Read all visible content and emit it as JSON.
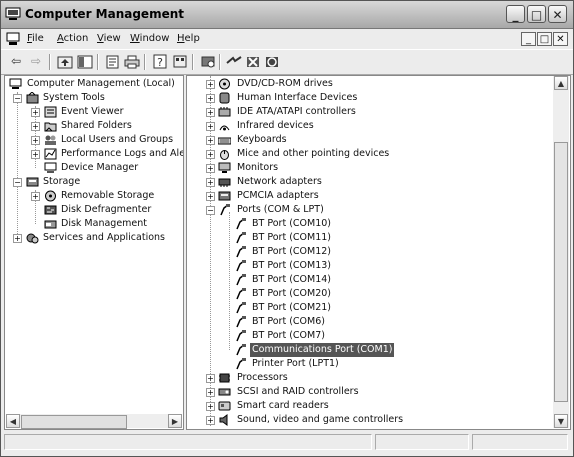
{
  "window": {
    "title": "Computer Management"
  },
  "menu": {
    "items": [
      {
        "underline": "F",
        "rest": "ile"
      },
      {
        "underline": "A",
        "rest": "ction"
      },
      {
        "underline": "V",
        "rest": "iew"
      },
      {
        "underline": "W",
        "rest": "indow"
      },
      {
        "underline": "H",
        "rest": "elp"
      }
    ]
  },
  "left_tree": {
    "root": "Computer Management (Local)",
    "system_tools": "System Tools",
    "event_viewer": "Event Viewer",
    "shared_folders": "Shared Folders",
    "local_users": "Local Users and Groups",
    "perf_logs": "Performance Logs and Alerts",
    "device_manager": "Device Manager",
    "storage": "Storage",
    "removable_storage": "Removable Storage",
    "disk_defrag": "Disk Defragmenter",
    "disk_management": "Disk Management",
    "services_apps": "Services and Applications"
  },
  "right_tree": {
    "dvd": "DVD/CD-ROM drives",
    "hid": "Human Interface Devices",
    "ide": "IDE ATA/ATAPI controllers",
    "infrared": "Infrared devices",
    "keyboards": "Keyboards",
    "mice": "Mice and other pointing devices",
    "monitors": "Monitors",
    "network": "Network adapters",
    "pcmcia": "PCMCIA adapters",
    "ports": "Ports (COM & LPT)",
    "bt10": "BT Port (COM10)",
    "bt11": "BT Port (COM11)",
    "bt12": "BT Port (COM12)",
    "bt13": "BT Port (COM13)",
    "bt14": "BT Port (COM14)",
    "bt20": "BT Port (COM20)",
    "bt21": "BT Port (COM21)",
    "bt6": "BT Port (COM6)",
    "bt7": "BT Port (COM7)",
    "com1": "Communications Port (COM1)",
    "lpt1": "Printer Port (LPT1)",
    "processors": "Processors",
    "scsi": "SCSI and RAID controllers",
    "smartcard": "Smart card readers",
    "sound": "Sound, video and game controllers"
  },
  "glyphs": {
    "plus": "+",
    "minus": "−",
    "min": "_",
    "max": "□",
    "close": "✕",
    "back": "⇦",
    "forward": "⇨",
    "up": "▲",
    "down": "▼",
    "left": "◀",
    "right": "▶"
  }
}
